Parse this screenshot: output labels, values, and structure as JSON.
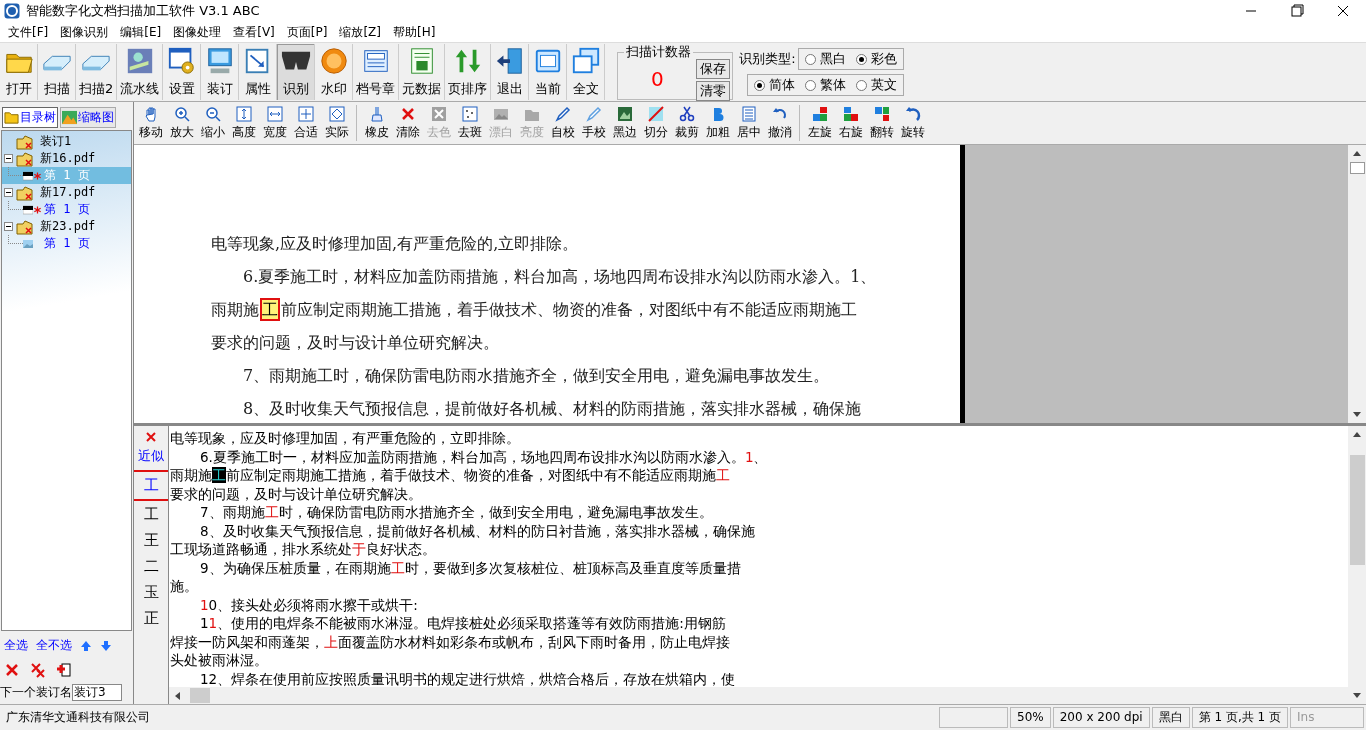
{
  "window": {
    "title": "智能数字化文档扫描加工软件 V3.1 ABC"
  },
  "menu": [
    "文件[F]",
    "图像识别",
    "编辑[E]",
    "图像处理",
    "查看[V]",
    "页面[P]",
    "缩放[Z]",
    "帮助[H]"
  ],
  "toolbar": [
    {
      "label": "打开",
      "pressed": false
    },
    {
      "label": "扫描",
      "pressed": false
    },
    {
      "label": "扫描2",
      "pressed": false
    },
    {
      "label": "流水线",
      "pressed": false
    },
    {
      "label": "设置",
      "pressed": false
    },
    {
      "label": "装订",
      "pressed": false
    },
    {
      "label": "属性",
      "pressed": false
    },
    {
      "label": "识别",
      "pressed": true
    },
    {
      "label": "水印",
      "pressed": false
    },
    {
      "label": "档号章",
      "pressed": false
    },
    {
      "label": "元数据",
      "pressed": false
    },
    {
      "label": "页排序",
      "pressed": false
    },
    {
      "label": "退出",
      "pressed": false
    },
    {
      "label": "当前",
      "pressed": false
    },
    {
      "label": "全文",
      "pressed": false
    }
  ],
  "scan_counter": {
    "title": "扫描计数器",
    "value": "0",
    "buttons": [
      "保存",
      "清零"
    ]
  },
  "recognition": {
    "label": "识别类型:",
    "color_modes": [
      {
        "label": "黑白",
        "selected": false
      },
      {
        "label": "彩色",
        "selected": true
      }
    ],
    "scripts": [
      {
        "label": "简体",
        "selected": true
      },
      {
        "label": "繁体",
        "selected": false
      },
      {
        "label": "英文",
        "selected": false
      }
    ]
  },
  "tools": [
    [
      {
        "label": "移动",
        "disabled": false
      },
      {
        "label": "放大",
        "disabled": false
      },
      {
        "label": "缩小",
        "disabled": false
      },
      {
        "label": "高度",
        "disabled": false
      },
      {
        "label": "宽度",
        "disabled": false
      },
      {
        "label": "合适",
        "disabled": false
      },
      {
        "label": "实际",
        "disabled": false
      }
    ],
    [
      {
        "label": "橡皮",
        "disabled": false
      },
      {
        "label": "清除",
        "disabled": false
      },
      {
        "label": "去色",
        "disabled": true
      },
      {
        "label": "去斑",
        "disabled": false
      },
      {
        "label": "漂白",
        "disabled": true
      },
      {
        "label": "亮度",
        "disabled": true
      },
      {
        "label": "自校",
        "disabled": false
      },
      {
        "label": "手校",
        "disabled": false
      },
      {
        "label": "黑边",
        "disabled": false
      },
      {
        "label": "切分",
        "disabled": false
      },
      {
        "label": "裁剪",
        "disabled": false
      },
      {
        "label": "加粗",
        "disabled": false
      },
      {
        "label": "居中",
        "disabled": false
      },
      {
        "label": "撤消",
        "disabled": false
      }
    ],
    [
      {
        "label": "左旋",
        "disabled": false
      },
      {
        "label": "右旋",
        "disabled": false
      },
      {
        "label": "翻转",
        "disabled": false
      },
      {
        "label": "旋转",
        "disabled": false
      }
    ]
  ],
  "sidebar": {
    "tabs": [
      {
        "label": "目录树",
        "selected": true
      },
      {
        "label": "缩略图",
        "selected": false
      }
    ],
    "tree": [
      {
        "label": "装订1"
      },
      {
        "label": "新16.pdf",
        "expanded": true,
        "children": [
          {
            "label": "第 1 页",
            "selected": true,
            "flagged": true,
            "kind": "mono"
          }
        ]
      },
      {
        "label": "新17.pdf",
        "expanded": true,
        "children": [
          {
            "label": "第 1 页",
            "selected": false,
            "flagged": true,
            "kind": "mono"
          }
        ]
      },
      {
        "label": "新23.pdf",
        "expanded": true,
        "children": [
          {
            "label": "第 1 页",
            "selected": false,
            "flagged": false,
            "kind": "color"
          }
        ]
      }
    ],
    "links": [
      "全选",
      "全不选"
    ],
    "next_binding": {
      "label": "下一个装订名",
      "value": "装订3"
    }
  },
  "document": {
    "lines": [
      {
        "indent": false,
        "segments": [
          {
            "text": "电等现象,应及时修理加固,有严重危险的,立即排除。",
            "kind": "plain"
          }
        ]
      },
      {
        "indent": true,
        "segments": [
          {
            "text": "6.夏季施工时，材料应加盖防雨措施，料台加高，场地四周布设排水沟以防雨水渗入。1、",
            "kind": "plain"
          }
        ]
      },
      {
        "indent": false,
        "segments": [
          {
            "text": "雨期施",
            "kind": "plain"
          },
          {
            "text": "工",
            "kind": "boxed"
          },
          {
            "text": "前应制定雨期施工措施，着手做技术、物资的准备，对图纸中有不能适应雨期施工",
            "kind": "plain"
          }
        ]
      },
      {
        "indent": false,
        "segments": [
          {
            "text": "要求的问题，及时与设计单位研究解决。",
            "kind": "plain"
          }
        ]
      },
      {
        "indent": true,
        "segments": [
          {
            "text": "7、雨期施工时，确保防雷电防雨水措施齐全，做到安全用电，避免漏电事故发生。",
            "kind": "plain"
          }
        ]
      },
      {
        "indent": true,
        "segments": [
          {
            "text": "8、及时收集天气预报信息，提前做好各机械、材料的防雨措施，落实排水器械，确保施",
            "kind": "plain"
          }
        ]
      }
    ]
  },
  "candidates": {
    "heading": "近似",
    "current": "工",
    "options": [
      "工",
      "王",
      "二",
      "玉",
      "正"
    ]
  },
  "recognized_text": {
    "lines": [
      {
        "indent": false,
        "segments": [
          {
            "text": "电等现象，应及时修理加固，有严重危险的，立即排除。",
            "kind": "plain"
          }
        ]
      },
      {
        "indent": true,
        "segments": [
          {
            "text": "6.夏季施工时一，材料应加盖防雨措施，料台加高，场地四周布设排水沟以防雨水渗入。",
            "kind": "plain"
          },
          {
            "text": "1",
            "kind": "flagged"
          },
          {
            "text": "、",
            "kind": "plain"
          }
        ]
      },
      {
        "indent": false,
        "segments": [
          {
            "text": "雨期施",
            "kind": "plain"
          },
          {
            "text": "工",
            "kind": "cursor"
          },
          {
            "text": "前应制定雨期施工措施，着手做技术、物资的准备，对图纸中有不能适应雨期施",
            "kind": "plain"
          },
          {
            "text": "工",
            "kind": "flagged"
          }
        ]
      },
      {
        "indent": false,
        "segments": [
          {
            "text": "要求的问题，及时与设计单位研究解决。",
            "kind": "plain"
          }
        ]
      },
      {
        "indent": true,
        "segments": [
          {
            "text": "7、雨期施",
            "kind": "plain"
          },
          {
            "text": "工",
            "kind": "flagged"
          },
          {
            "text": "时，确保防雷电防雨水措施齐全，做到安全用电，避免漏电事故发生。",
            "kind": "plain"
          }
        ]
      },
      {
        "indent": true,
        "segments": [
          {
            "text": "8、及时收集天气预报信息，提前做好各机械、材料的防日衬昔施，落实排水器械，确保施",
            "kind": "plain"
          }
        ]
      },
      {
        "indent": false,
        "segments": [
          {
            "text": "工现场道路畅通，排水系统处",
            "kind": "plain"
          },
          {
            "text": "于",
            "kind": "flagged"
          },
          {
            "text": "良好状态。",
            "kind": "plain"
          }
        ]
      },
      {
        "indent": true,
        "segments": [
          {
            "text": "9、为确保压桩质量，在雨期施",
            "kind": "plain"
          },
          {
            "text": "工",
            "kind": "flagged"
          },
          {
            "text": "时，要做到多次复核桩位、桩顶标高及垂直度等质量措",
            "kind": "plain"
          }
        ]
      },
      {
        "indent": false,
        "segments": [
          {
            "text": "施。",
            "kind": "plain"
          }
        ]
      },
      {
        "indent": true,
        "segments": [
          {
            "text": "1",
            "kind": "flagged"
          },
          {
            "text": "0、接头处必须将雨水擦干或烘干:",
            "kind": "plain"
          }
        ]
      },
      {
        "indent": true,
        "segments": [
          {
            "text": "1",
            "kind": "plain"
          },
          {
            "text": "1",
            "kind": "flagged"
          },
          {
            "text": "、使用的电焊条不能被雨水淋湿。电焊接桩处必须采取搭蓬等有效防雨措施:用钢筋",
            "kind": "plain"
          }
        ]
      },
      {
        "indent": false,
        "segments": [
          {
            "text": "焊接一防风架和雨蓬架，",
            "kind": "plain"
          },
          {
            "text": "上",
            "kind": "flagged"
          },
          {
            "text": "面覆盖防水材料如彩条布或帆布，刮风下雨时备用，防止电焊接",
            "kind": "plain"
          }
        ]
      },
      {
        "indent": false,
        "segments": [
          {
            "text": "头处被雨淋湿。",
            "kind": "plain"
          }
        ]
      },
      {
        "indent": true,
        "segments": [
          {
            "text": "12、焊条在使用前应按照质量讯明书的规定进行烘焙，烘焙合格后，存放在烘箱内，使",
            "kind": "plain"
          }
        ]
      }
    ]
  },
  "status_bar": [
    {
      "text": "广东清华文通科技有限公司",
      "disabled": false
    },
    {
      "text": "50%",
      "disabled": false
    },
    {
      "text": "200 x 200 dpi",
      "disabled": false
    },
    {
      "text": "黑白",
      "disabled": false
    },
    {
      "text": "第 1 页,共 1 页",
      "disabled": false
    },
    {
      "text": "Ins",
      "disabled": true
    }
  ]
}
